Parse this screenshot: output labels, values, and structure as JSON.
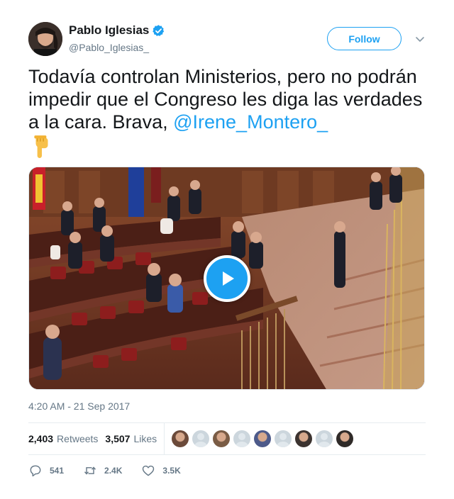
{
  "author": {
    "display_name": "Pablo Iglesias",
    "handle": "@Pablo_Iglesias_",
    "verified_icon": "verified-badge-icon"
  },
  "follow_label": "Follow",
  "tweet": {
    "text_before": "Todavía controlan Ministerios, pero no podrán impedir que el Congreso les diga las verdades a la cara. Brava, ",
    "mention": "@Irene_Montero_",
    "emoji_icon": "pointing-down-hand-icon"
  },
  "timestamp": "4:20 AM - 21 Sep 2017",
  "stats": {
    "retweets_count": "2,403",
    "retweets_label": "Retweets",
    "likes_count": "3,507",
    "likes_label": "Likes"
  },
  "liker_faces": [
    "photo",
    "default",
    "photo",
    "default",
    "photo",
    "default",
    "photo",
    "default",
    "photo"
  ],
  "actions": {
    "replies": "541",
    "retweets": "2.4K",
    "likes": "3.5K"
  },
  "colors": {
    "accent": "#1da1f2",
    "secondary_text": "#657786",
    "primary_text": "#14171a"
  }
}
